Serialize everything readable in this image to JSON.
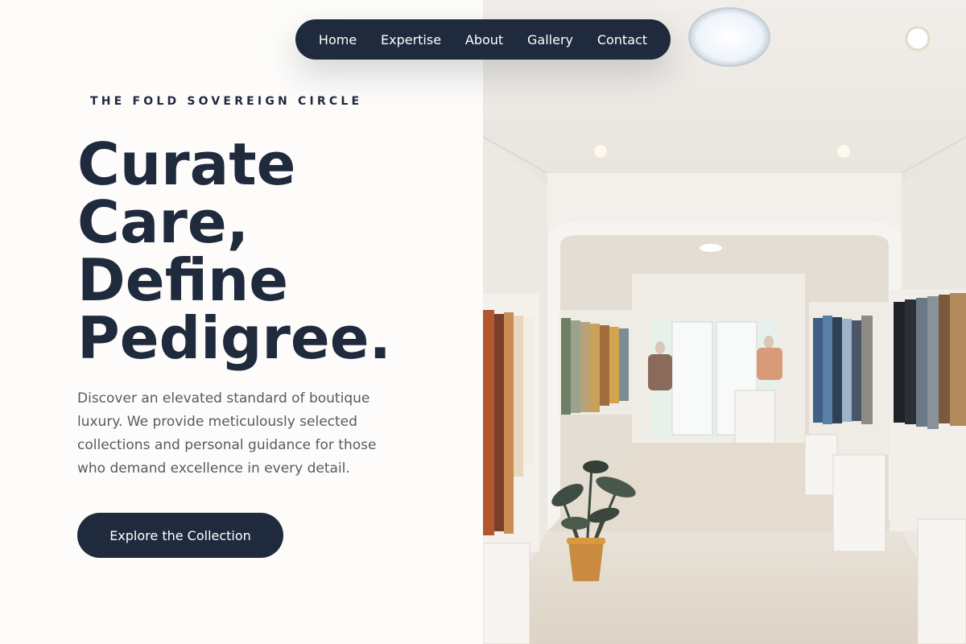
{
  "nav": {
    "items": [
      {
        "label": "Home"
      },
      {
        "label": "Expertise"
      },
      {
        "label": "About"
      },
      {
        "label": "Gallery"
      },
      {
        "label": "Contact"
      }
    ]
  },
  "hero": {
    "eyebrow": "THE FOLD SOVEREIGN CIRCLE",
    "headline": [
      "Curate",
      "Care,",
      "Define",
      "Pedigree."
    ],
    "description": "Discover an elevated standard of boutique luxury. We provide meticulously selected collections and personal guidance for those who demand excellence in every detail.",
    "cta_label": "Explore the Collection"
  },
  "image": {
    "subject": "boutique clothing store interior with racks of garments, mannequins and a potted plant"
  }
}
